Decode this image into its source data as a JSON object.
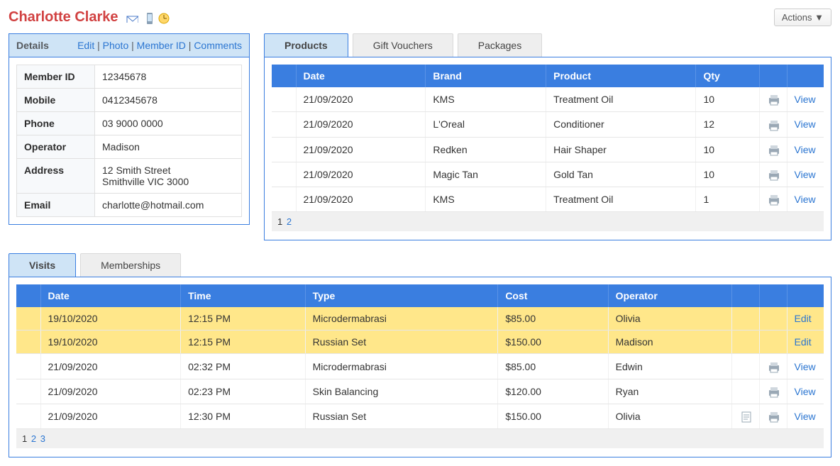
{
  "header": {
    "customer_name": "Charlotte Clarke",
    "actions_label": "Actions ▼"
  },
  "details": {
    "title": "Details",
    "links": {
      "edit": "Edit",
      "photo": "Photo",
      "member_id": "Member ID",
      "comments": "Comments"
    },
    "rows": {
      "member_id_label": "Member ID",
      "member_id": "12345678",
      "mobile_label": "Mobile",
      "mobile": "0412345678",
      "phone_label": "Phone",
      "phone": "03 9000 0000",
      "operator_label": "Operator",
      "operator": "Madison",
      "address_label": "Address",
      "address_line1": "12 Smith Street",
      "address_line2": "Smithville VIC 3000",
      "email_label": "Email",
      "email": "charlotte@hotmail.com"
    }
  },
  "purchase_tabs": {
    "products": "Products",
    "gift_vouchers": "Gift Vouchers",
    "packages": "Packages"
  },
  "products": {
    "columns": {
      "date": "Date",
      "brand": "Brand",
      "product": "Product",
      "qty": "Qty"
    },
    "rows": [
      {
        "date": "21/09/2020",
        "brand": "KMS",
        "product": "Treatment Oil",
        "qty": "10",
        "action": "View"
      },
      {
        "date": "21/09/2020",
        "brand": "L'Oreal",
        "product": "Conditioner",
        "qty": "12",
        "action": "View"
      },
      {
        "date": "21/09/2020",
        "brand": "Redken",
        "product": "Hair Shaper",
        "qty": "10",
        "action": "View"
      },
      {
        "date": "21/09/2020",
        "brand": "Magic Tan",
        "product": "Gold Tan",
        "qty": "10",
        "action": "View"
      },
      {
        "date": "21/09/2020",
        "brand": "KMS",
        "product": "Treatment Oil",
        "qty": "1",
        "action": "View"
      }
    ],
    "pager": {
      "current": "1",
      "p2": "2"
    }
  },
  "visits_tabs": {
    "visits": "Visits",
    "memberships": "Memberships"
  },
  "visits": {
    "columns": {
      "date": "Date",
      "time": "Time",
      "type": "Type",
      "cost": "Cost",
      "operator": "Operator"
    },
    "rows": [
      {
        "date": "19/10/2020",
        "time": "12:15 PM",
        "type": "Microdermabrasi",
        "cost": "$85.00",
        "operator": "Olivia",
        "highlight": true,
        "has_note": false,
        "has_print": false,
        "action": "Edit"
      },
      {
        "date": "19/10/2020",
        "time": "12:15 PM",
        "type": "Russian Set",
        "cost": "$150.00",
        "operator": "Madison",
        "highlight": true,
        "has_note": false,
        "has_print": false,
        "action": "Edit"
      },
      {
        "date": "21/09/2020",
        "time": "02:32 PM",
        "type": "Microdermabrasi",
        "cost": "$85.00",
        "operator": "Edwin",
        "highlight": false,
        "has_note": false,
        "has_print": true,
        "action": "View"
      },
      {
        "date": "21/09/2020",
        "time": "02:23 PM",
        "type": "Skin Balancing",
        "cost": "$120.00",
        "operator": "Ryan",
        "highlight": false,
        "has_note": false,
        "has_print": true,
        "action": "View"
      },
      {
        "date": "21/09/2020",
        "time": "12:30 PM",
        "type": "Russian Set",
        "cost": "$150.00",
        "operator": "Olivia",
        "highlight": false,
        "has_note": true,
        "has_print": true,
        "action": "View"
      }
    ],
    "pager": {
      "current": "1",
      "p2": "2",
      "p3": "3"
    }
  }
}
